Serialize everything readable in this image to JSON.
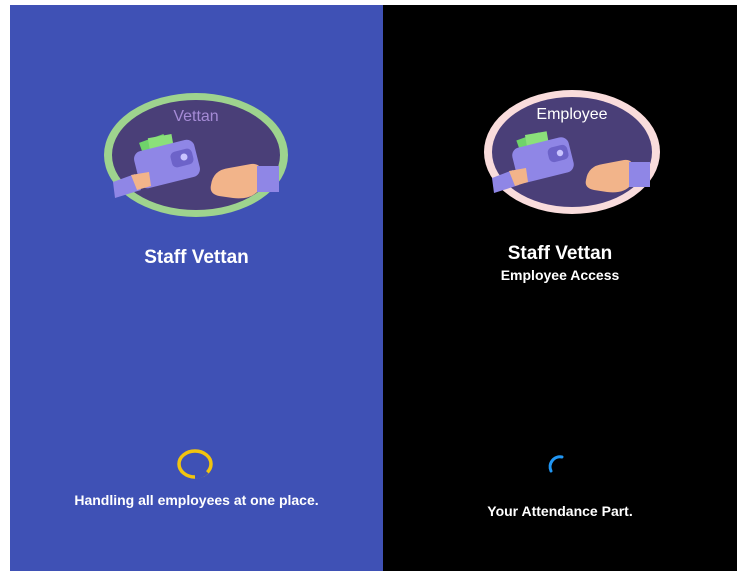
{
  "screens": {
    "admin": {
      "logo_text": "Vettan",
      "title": "Staff Vettan",
      "tagline": "Handling all employees at one place.",
      "colors": {
        "background": "#3f51b5",
        "ring": "#9ed38e",
        "logo_fill": "#4a3f78",
        "logo_text": "#a58bd6",
        "spinner": "#f1c40f"
      },
      "icon": "wallet-handover-icon"
    },
    "employee": {
      "logo_text": "Employee",
      "title": "Staff Vettan",
      "subtitle": "Employee Access",
      "tagline": "Your Attendance Part.",
      "colors": {
        "background": "#000000",
        "ring": "#f9dcdc",
        "logo_fill": "#4a3f78",
        "logo_text": "#ffffff",
        "spinner": "#2196f3"
      },
      "icon": "wallet-handover-icon"
    }
  }
}
